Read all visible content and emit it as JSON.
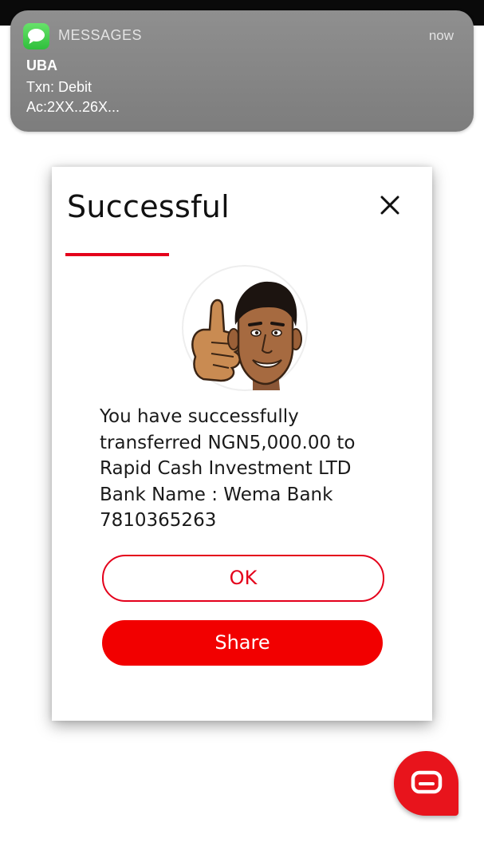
{
  "notification": {
    "app_name": "MESSAGES",
    "time": "now",
    "sender": "UBA",
    "lines": [
      "Txn: Debit",
      "Ac:2XX..26X..."
    ],
    "app_icon": "messages-bubble-icon"
  },
  "dialog": {
    "title": "Successful",
    "close_icon": "close-icon",
    "mascot": "thumbs-up-mascot",
    "message_lines": [
      "You have successfully",
      "transferred NGN5,000.00 to",
      "Rapid Cash Investment LTD",
      "Bank Name : Wema Bank",
      "7810365263"
    ],
    "ok_label": "OK",
    "share_label": "Share"
  },
  "fab": {
    "icon": "chat-icon"
  },
  "colors": {
    "accent": "#e4001b",
    "share_button": "#f20000",
    "notification_bg": "#888888",
    "messages_icon": "#3dcb47"
  }
}
